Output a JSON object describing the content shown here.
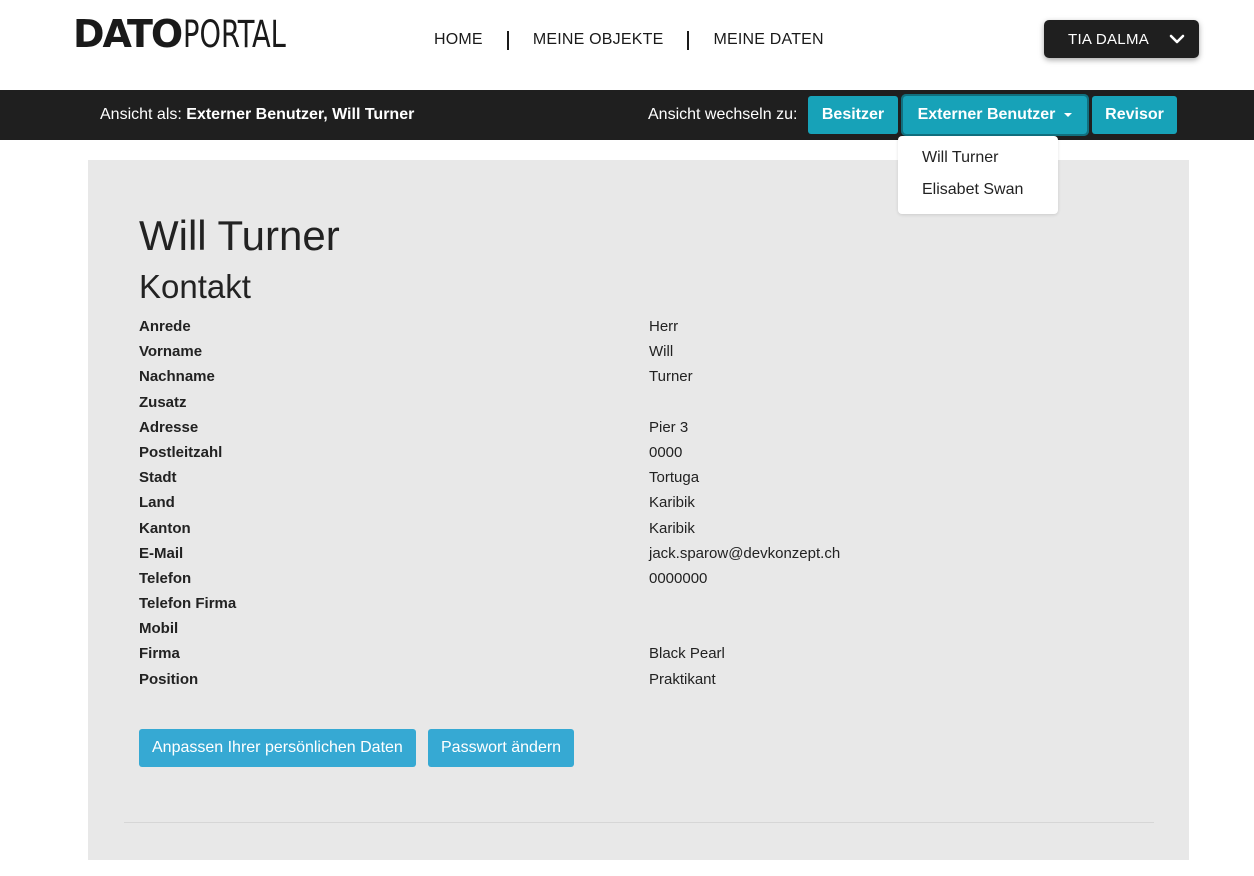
{
  "header": {
    "logo_dato": "DATO",
    "logo_portal": "PORTAL",
    "nav": [
      "HOME",
      "MEINE OBJEKTE",
      "MEINE DATEN"
    ],
    "user_name": "TIA DALMA"
  },
  "viewbar": {
    "view_as_prefix": "Ansicht als: ",
    "view_as_value": "Externer Benutzer, Will Turner",
    "switch_label": "Ansicht wechseln zu:",
    "buttons": {
      "owner": "Besitzer",
      "external": "Externer Benutzer",
      "auditor": "Revisor"
    },
    "dropdown_items": [
      "Will Turner",
      "Elisabet Swan"
    ]
  },
  "main": {
    "title": "Will Turner",
    "section": "Kontakt",
    "fields": [
      {
        "label": "Anrede",
        "value": "Herr"
      },
      {
        "label": "Vorname",
        "value": "Will"
      },
      {
        "label": "Nachname",
        "value": "Turner"
      },
      {
        "label": "Zusatz",
        "value": ""
      },
      {
        "label": "Adresse",
        "value": "Pier 3"
      },
      {
        "label": "Postleitzahl",
        "value": "0000"
      },
      {
        "label": "Stadt",
        "value": "Tortuga"
      },
      {
        "label": "Land",
        "value": "Karibik"
      },
      {
        "label": "Kanton",
        "value": "Karibik"
      },
      {
        "label": "E-Mail",
        "value": "jack.sparow@devkonzept.ch"
      },
      {
        "label": "Telefon",
        "value": "0000000"
      },
      {
        "label": "Telefon Firma",
        "value": ""
      },
      {
        "label": "Mobil",
        "value": ""
      },
      {
        "label": "Firma",
        "value": "Black Pearl"
      },
      {
        "label": "Position",
        "value": "Praktikant"
      }
    ],
    "buttons": {
      "edit": "Anpassen Ihrer persönlichen Daten",
      "password": "Passwort ändern"
    }
  },
  "colors": {
    "accent": "#17a2b8",
    "action": "#36a9d3",
    "dark": "#1f1f1f",
    "card": "#e8e8e8"
  },
  "icons": {
    "user_menu": "chevron-down-icon",
    "dropdown": "caret-down-icon"
  }
}
